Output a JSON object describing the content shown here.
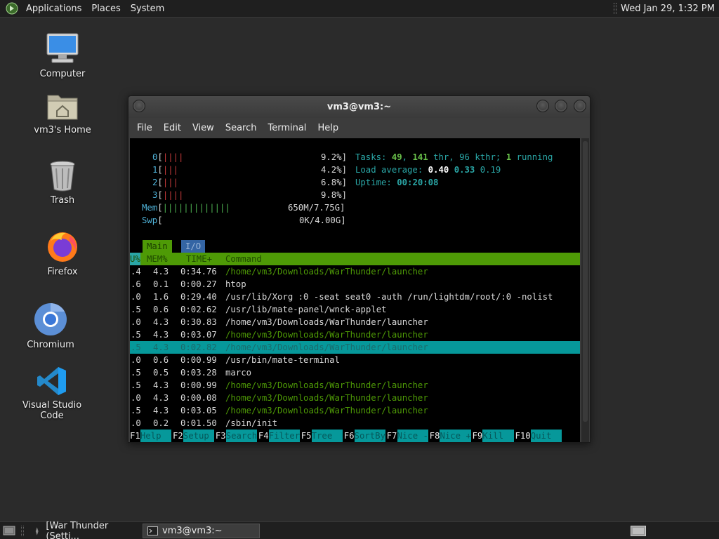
{
  "top_panel": {
    "menus": [
      "Applications",
      "Places",
      "System"
    ],
    "clock": "Wed Jan 29,  1:32 PM"
  },
  "desktop": {
    "icons": [
      {
        "label": "Computer",
        "icon": "computer-icon"
      },
      {
        "label": "vm3's Home",
        "icon": "home-folder-icon"
      },
      {
        "label": "Trash",
        "icon": "trash-icon"
      },
      {
        "label": "Firefox",
        "icon": "firefox-icon"
      },
      {
        "label": "Chromium",
        "icon": "chromium-icon"
      },
      {
        "label": "Visual Studio Code",
        "icon": "vscode-icon"
      }
    ]
  },
  "terminal": {
    "title": "vm3@vm3:~",
    "menu": [
      "File",
      "Edit",
      "View",
      "Search",
      "Terminal",
      "Help"
    ],
    "htop": {
      "cpus": [
        {
          "id": "0",
          "bars_red": "||||",
          "bars_green": "",
          "pct": "9.2%]"
        },
        {
          "id": "1",
          "bars_red": "|||",
          "bars_green": "",
          "pct": "4.2%]"
        },
        {
          "id": "2",
          "bars_red": "|||",
          "bars_green": "",
          "pct": "6.8%]"
        },
        {
          "id": "3",
          "bars_red": "||||",
          "bars_green": "",
          "pct": "9.8%]"
        }
      ],
      "mem": {
        "label": "Mem",
        "bars": "|||||||||||||",
        "value": "650M/7.75G]"
      },
      "swp": {
        "label": "Swp",
        "value": "0K/4.00G]"
      },
      "tasks": {
        "label": "Tasks:",
        "count": "49",
        "sep": ",",
        "thr": "141",
        "thr_label": "thr,",
        "kthr": "96 kthr;",
        "running": "1",
        "running_label": "running"
      },
      "load": {
        "label": "Load average:",
        "v1": "0.40",
        "v2": "0.33",
        "v3": "0.19"
      },
      "uptime": {
        "label": "Uptime:",
        "value": "00:20:08"
      },
      "tabs": {
        "main": "Main",
        "io": "I/O"
      },
      "header": {
        "c0": "U%",
        "c1": "MEM%",
        "c2": "TIME+",
        "c3": "Command"
      },
      "processes": [
        {
          "cpu": ".4",
          "mem": "4.3",
          "time": "0:34.76",
          "cmd": "/home/vm3/Downloads/WarThunder/launcher",
          "dim": true
        },
        {
          "cpu": ".6",
          "mem": "0.1",
          "time": "0:00.27",
          "cmd": "htop",
          "dim": false
        },
        {
          "cpu": ".0",
          "mem": "1.6",
          "time": "0:29.40",
          "cmd": "/usr/lib/Xorg :0 -seat seat0 -auth /run/lightdm/root/:0 -nolist",
          "dim": false
        },
        {
          "cpu": ".5",
          "mem": "0.6",
          "time": "0:02.62",
          "cmd": "/usr/lib/mate-panel/wnck-applet",
          "dim": false
        },
        {
          "cpu": ".0",
          "mem": "4.3",
          "time": "0:30.83",
          "cmd": "/home/vm3/Downloads/WarThunder/launcher",
          "dim": false
        },
        {
          "cpu": ".5",
          "mem": "4.3",
          "time": "0:03.07",
          "cmd": "/home/vm3/Downloads/WarThunder/launcher",
          "dim": true
        },
        {
          "cpu": ".5",
          "mem": "4.3",
          "time": "0:02.82",
          "cmd": "/home/vm3/Downloads/WarThunder/launcher",
          "dim": true,
          "selected": true
        },
        {
          "cpu": ".0",
          "mem": "0.6",
          "time": "0:00.99",
          "cmd": "/usr/bin/mate-terminal",
          "dim": false
        },
        {
          "cpu": ".5",
          "mem": "0.5",
          "time": "0:03.28",
          "cmd": "marco",
          "dim": false
        },
        {
          "cpu": ".5",
          "mem": "4.3",
          "time": "0:00.99",
          "cmd": "/home/vm3/Downloads/WarThunder/launcher",
          "dim": true
        },
        {
          "cpu": ".0",
          "mem": "4.3",
          "time": "0:00.08",
          "cmd": "/home/vm3/Downloads/WarThunder/launcher",
          "dim": true
        },
        {
          "cpu": ".5",
          "mem": "4.3",
          "time": "0:03.05",
          "cmd": "/home/vm3/Downloads/WarThunder/launcher",
          "dim": true
        },
        {
          "cpu": ".0",
          "mem": "0.2",
          "time": "0:01.50",
          "cmd": "/sbin/init",
          "dim": false
        }
      ],
      "fkeys": [
        {
          "key": "F1",
          "label": "Help  "
        },
        {
          "key": "F2",
          "label": "Setup "
        },
        {
          "key": "F3",
          "label": "Search"
        },
        {
          "key": "F4",
          "label": "Filter"
        },
        {
          "key": "F5",
          "label": "Tree  "
        },
        {
          "key": "F6",
          "label": "SortBy"
        },
        {
          "key": "F7",
          "label": "Nice -"
        },
        {
          "key": "F8",
          "label": "Nice +"
        },
        {
          "key": "F9",
          "label": "Kill  "
        },
        {
          "key": "F10",
          "label": "Quit  "
        }
      ]
    }
  },
  "bottom_panel": {
    "tasks": [
      {
        "label": "[War Thunder (Setti...",
        "active": false
      },
      {
        "label": "vm3@vm3:~",
        "active": true
      }
    ]
  }
}
